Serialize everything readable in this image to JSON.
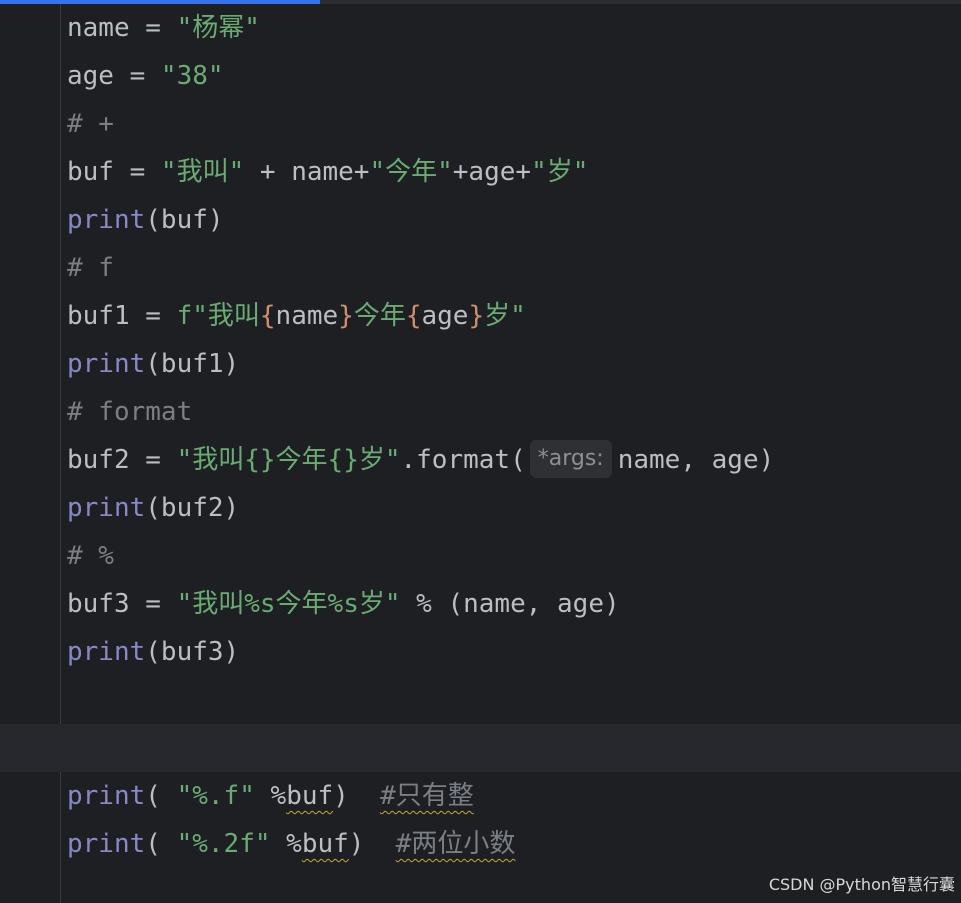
{
  "editor": {
    "lines": [
      [
        "name = ",
        "\"杨幂\""
      ],
      [
        "age = ",
        "\"38\""
      ],
      [
        "# +"
      ],
      [
        "buf = ",
        "\"我叫\"",
        " + name+",
        "\"今年\"",
        "+age+",
        "\"岁\""
      ],
      [
        "print",
        "(buf)"
      ],
      [
        "# f"
      ],
      [
        "buf1 = ",
        "f\"我叫",
        "{",
        "name",
        "}",
        "今年",
        "{",
        "age",
        "}",
        "岁\""
      ],
      [
        "print",
        "(buf1)"
      ],
      [
        "# format"
      ],
      [
        "buf2 = ",
        "\"我叫{}今年{}岁\"",
        ".format(",
        "name, age)"
      ],
      [
        "print",
        "(buf2)"
      ],
      [
        "# %"
      ],
      [
        "buf3 = ",
        "\"我叫%s今年%s岁\"",
        " % (name, age)"
      ],
      [
        "print",
        "(buf3)"
      ],
      [],
      [],
      [
        "print",
        "( ",
        "\"%.f\"",
        " %",
        "buf",
        ")  ",
        "#只有整"
      ],
      [
        "print",
        "( ",
        "\"%.2f\"",
        " %",
        "buf",
        ")  ",
        "#两位小数"
      ]
    ],
    "param_hint": "*args:"
  },
  "watermark": "CSDN @Python智慧行囊",
  "colors": {
    "background": "#1e1f22",
    "current_line": "#26282e",
    "accent": "#3574f0",
    "keyword": "#8888c6",
    "string": "#6aab73",
    "comment": "#7a7e85",
    "brace": "#cf8e6d",
    "text": "#bcbec4"
  }
}
